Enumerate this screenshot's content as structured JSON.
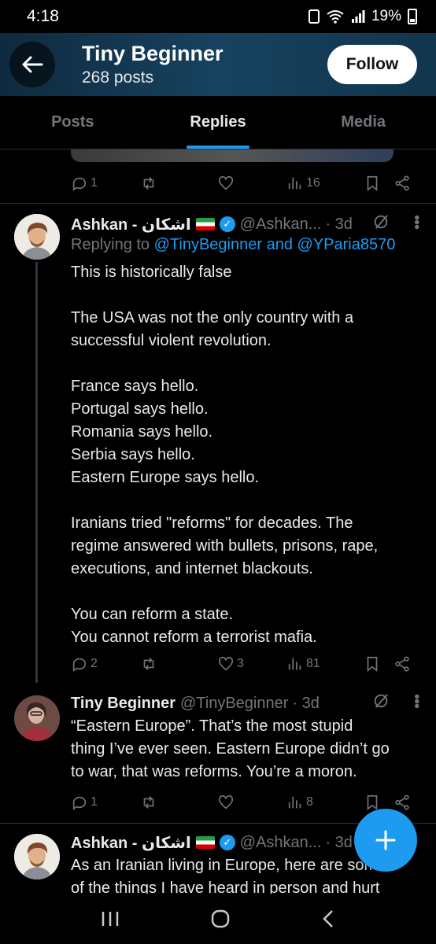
{
  "status_bar": {
    "time": "4:18",
    "battery": "19%"
  },
  "header": {
    "name": "Tiny Beginner",
    "posts": "268 posts",
    "follow_label": "Follow"
  },
  "tabs": [
    "Posts",
    "Replies",
    "Media"
  ],
  "top_actions": {
    "replies": "1",
    "views": "16"
  },
  "tweet1": {
    "name": "Ashkan - اشکان",
    "handle": "@Ashkan...",
    "time": "· 3d",
    "replying_prefix": "Replying to",
    "replying_users": "@TinyBeginner and @YParia8570",
    "lines": [
      "This is historically false",
      "",
      "The USA was not the only country with a",
      "successful violent revolution.",
      "",
      "France says hello.",
      "Portugal says hello.",
      "Romania says hello.",
      "Serbia says hello.",
      "Eastern Europe says hello.",
      "",
      "Iranians tried \"reforms\" for decades. The",
      "regime answered with bullets, prisons, rape,",
      "executions, and internet blackouts.",
      "",
      "You can reform a state.",
      "You cannot reform a terrorist mafia."
    ],
    "replies": "2",
    "likes": "3",
    "views": "81"
  },
  "tweet2": {
    "name": "Tiny Beginner",
    "handle": "@TinyBeginner",
    "time": "· 3d",
    "lines": [
      "“Eastern Europe”. That’s the most stupid",
      "thing I’ve ever seen. Eastern Europe didn’t go",
      "to war, that was reforms. You’re a moron."
    ],
    "replies": "1",
    "views": "8"
  },
  "tweet3": {
    "name": "Ashkan - اشکان",
    "handle": "@Ashkan...",
    "time": "· 3d",
    "lines": [
      "As an Iranian living in Europe, here are some",
      "of the things I have heard in person and hurt"
    ]
  },
  "colors": {
    "accent": "#1d9bf0",
    "muted": "#71767b",
    "text": "#e7e9ea",
    "header_bg": "#17425f"
  },
  "icons": [
    "back-arrow-icon",
    "reply-icon",
    "repost-icon",
    "like-icon",
    "views-icon",
    "bookmark-icon",
    "share-icon",
    "grok-icon",
    "more-icon",
    "compose-plus-icon"
  ]
}
